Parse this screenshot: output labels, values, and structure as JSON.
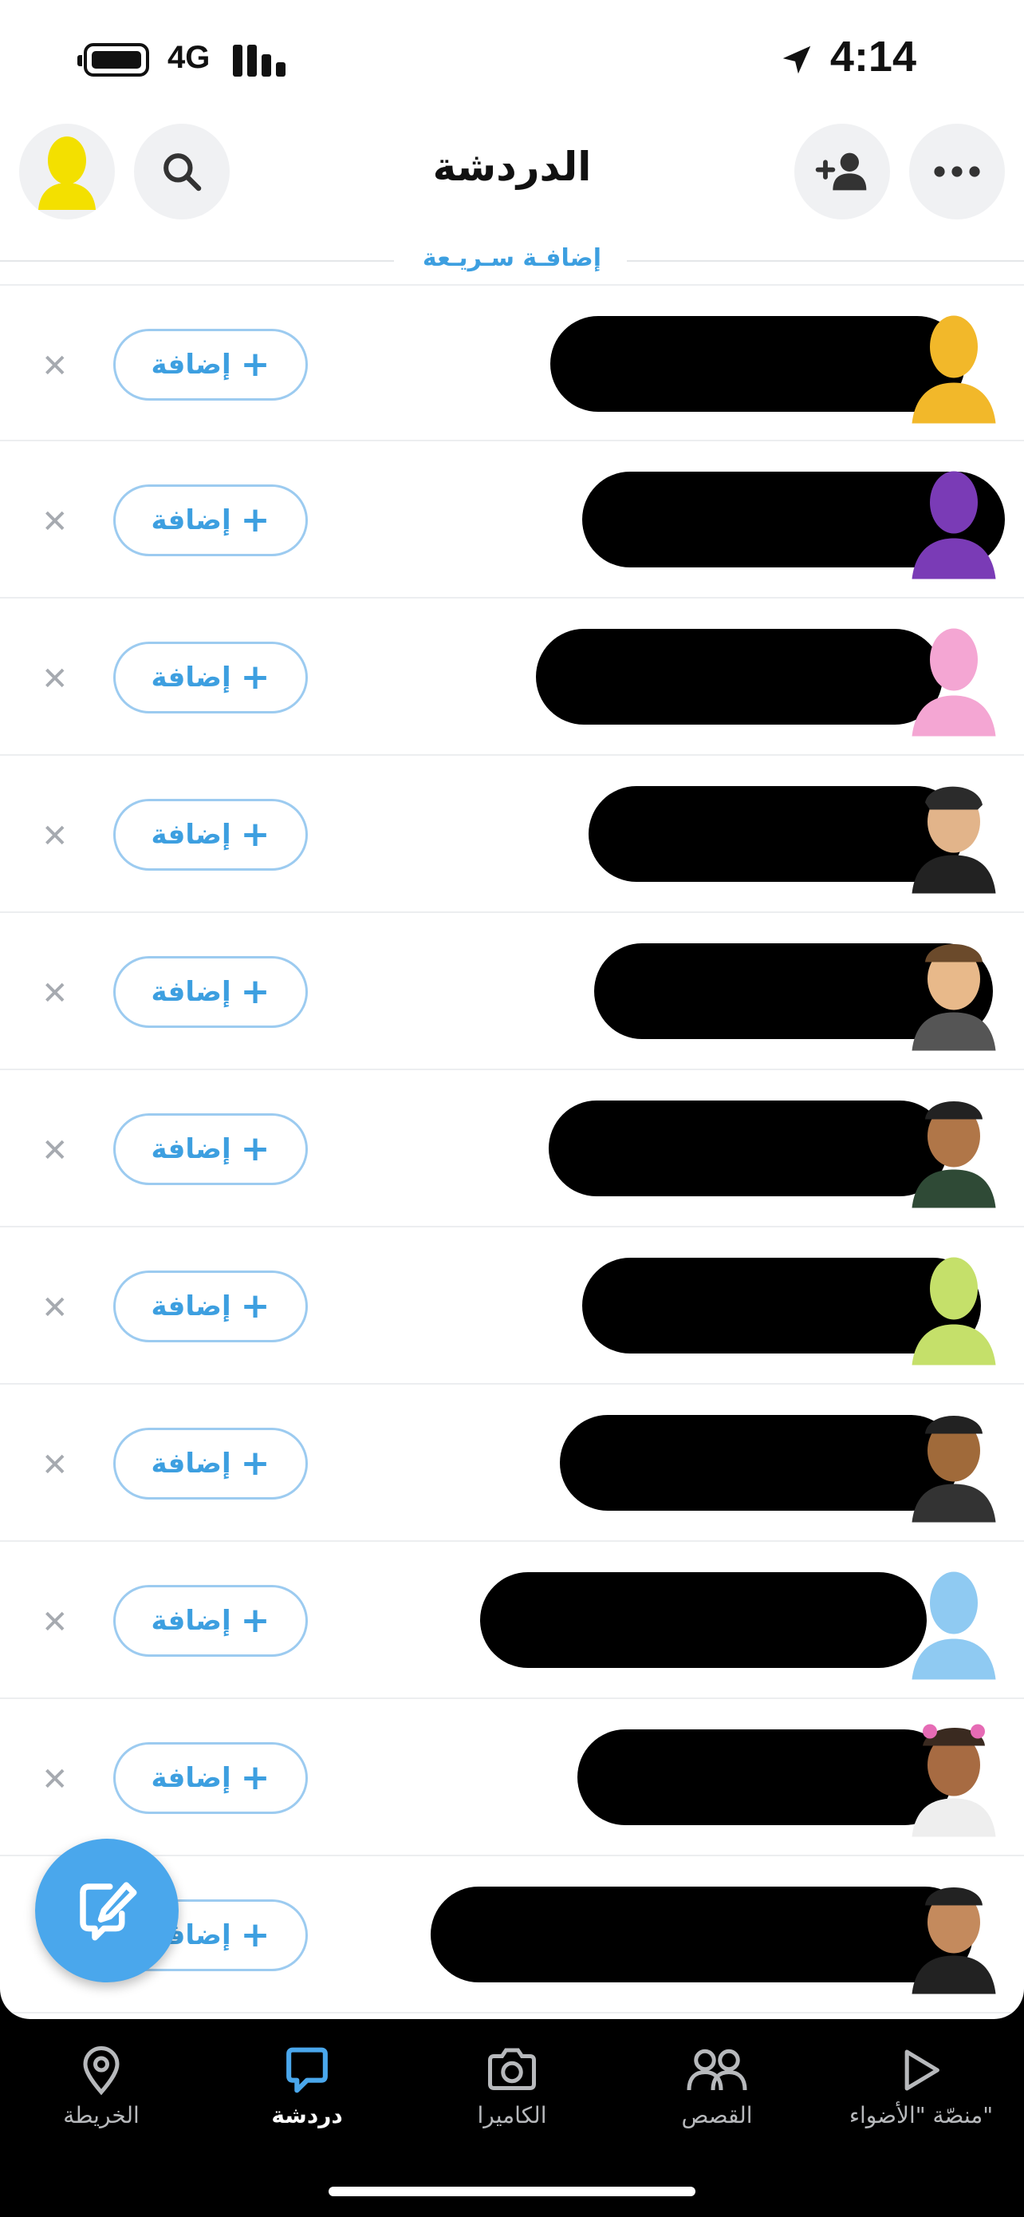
{
  "status": {
    "network": "4G",
    "time": "4:14"
  },
  "header": {
    "title": "الدردشة"
  },
  "quick_add": {
    "label": "إضافـة سـريـعة"
  },
  "rows": [
    {
      "add_label": "إضافة",
      "avatar_color": "#f2b82a"
    },
    {
      "add_label": "إضافة",
      "avatar_color": "#7a3bb6"
    },
    {
      "add_label": "إضافة",
      "avatar_color": "#f4a6d3"
    },
    {
      "add_label": "إضافة",
      "avatar_color": "#5a3a26"
    },
    {
      "add_label": "إضافة",
      "avatar_color": "#d7a36f"
    },
    {
      "add_label": "إضافة",
      "avatar_color": "#b07648"
    },
    {
      "add_label": "إضافة",
      "avatar_color": "#c5e06a"
    },
    {
      "add_label": "إضافة",
      "avatar_color": "#8f5b2e"
    },
    {
      "add_label": "إضافة",
      "avatar_color": "#8fcaf2"
    },
    {
      "add_label": "إضافة",
      "avatar_color": "#a76b42"
    },
    {
      "add_label": "إضافة",
      "avatar_color": "#c48a5d"
    }
  ],
  "tabs": [
    {
      "label": "الخريطة",
      "icon": "map-pin-icon"
    },
    {
      "label": "دردشة",
      "icon": "chat-icon",
      "active": true
    },
    {
      "label": "الكاميرا",
      "icon": "camera-icon"
    },
    {
      "label": "القصص",
      "icon": "stories-icon"
    },
    {
      "label": "منصّة \"الأضواء\"",
      "icon": "spotlight-icon"
    }
  ],
  "colors": {
    "accent": "#3d9fe0",
    "fab": "#4aa7ec"
  }
}
